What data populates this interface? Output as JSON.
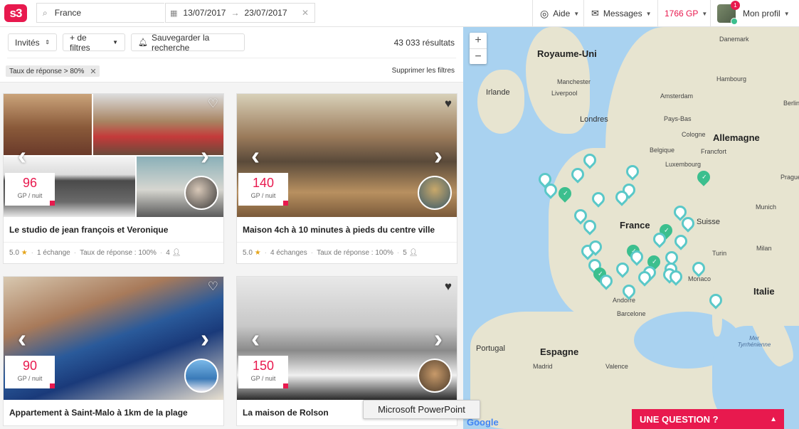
{
  "header": {
    "logo": "s3",
    "search_value": "France",
    "date_from": "13/07/2017",
    "date_to": "23/07/2017",
    "help": "Aide",
    "messages": "Messages",
    "gp_balance": "1766 GP",
    "profile": "Mon profil",
    "notif_count": "1"
  },
  "filters": {
    "guests": "Invités",
    "more": "+ de filtres",
    "save": "Sauvegarder la recherche",
    "results": "43 033 résultats",
    "tag": "Taux de réponse > 80%",
    "clear": "Supprimer les filtres"
  },
  "listings": [
    {
      "price": "96",
      "unit": "GP / nuit",
      "title": "Le studio de jean françois et Veronique",
      "rating": "5.0",
      "exchanges": "1 échange",
      "response": "Taux de réponse : 100%",
      "guests": "4"
    },
    {
      "price": "140",
      "unit": "GP / nuit",
      "title": "Maison 4ch à 10 minutes à pieds du centre ville",
      "rating": "5.0",
      "exchanges": "4 échanges",
      "response": "Taux de réponse : 100%",
      "guests": "5"
    },
    {
      "price": "90",
      "unit": "GP / nuit",
      "title": "Appartement à Saint-Malo à 1km de la plage"
    },
    {
      "price": "150",
      "unit": "GP / nuit",
      "title": "La maison de Rolson"
    }
  ],
  "map": {
    "labels": [
      "Royaume-Uni",
      "Irlande",
      "Manchester",
      "Liverpool",
      "Londres",
      "Danemark",
      "Hambourg",
      "Pays-Bas",
      "Amsterdam",
      "Belgique",
      "Allemagne",
      "Cologne",
      "Francfort",
      "Luxembourg",
      "France",
      "Suisse",
      "Italie",
      "Espagne",
      "Portugal",
      "Monaco",
      "Andorre",
      "Barcelone",
      "Valence",
      "Madrid",
      "Munich",
      "Milan",
      "Turin",
      "Mer Tyrrhénienne",
      "Prague",
      "Berlin"
    ],
    "zoom_in": "+",
    "zoom_out": "−",
    "google": "Google"
  },
  "question": "UNE QUESTION ?",
  "tooltip": "Microsoft PowerPoint"
}
